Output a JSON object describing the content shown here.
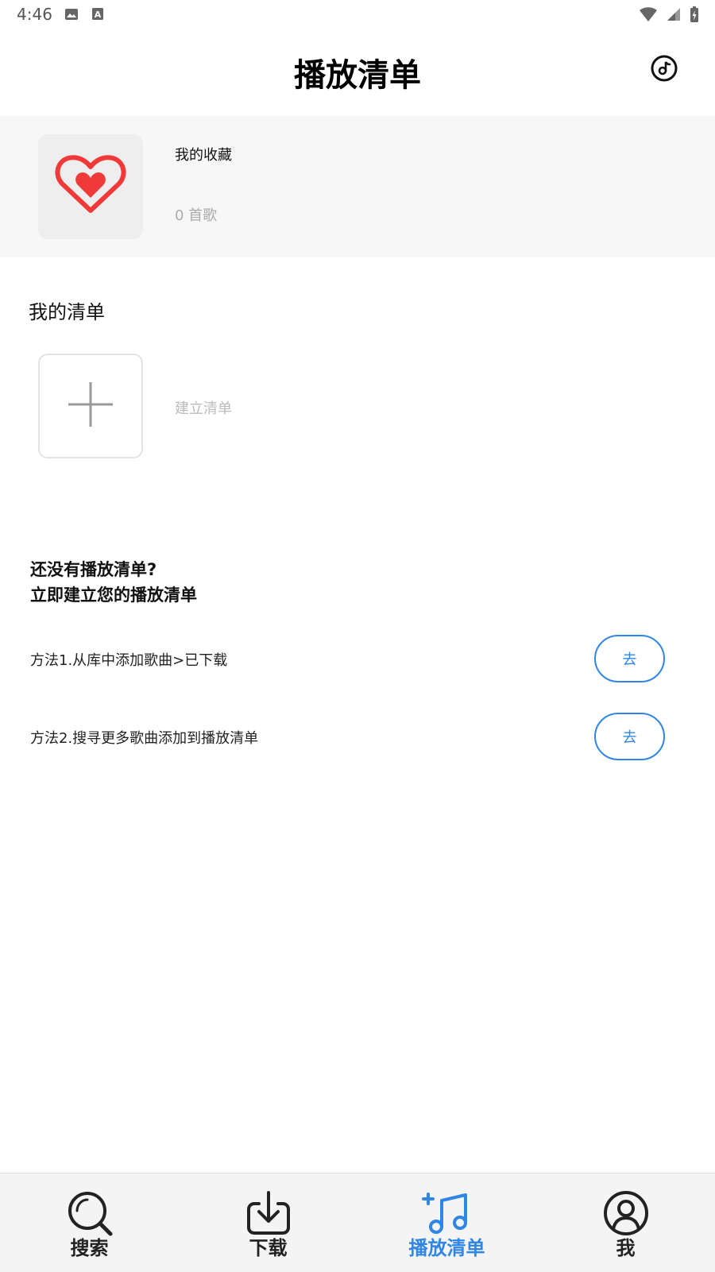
{
  "status_bar": {
    "time": "4:46"
  },
  "header": {
    "title": "播放清单"
  },
  "favorites": {
    "title": "我的收藏",
    "count": "0 首歌"
  },
  "my_playlists": {
    "heading": "我的清单",
    "create_label": "建立清单"
  },
  "empty_hint": {
    "line1": "还没有播放清单?",
    "line2": "立即建立您的播放清单",
    "methods": [
      {
        "text": "方法1.从库中添加歌曲>已下载",
        "button": "去"
      },
      {
        "text": "方法2.搜寻更多歌曲添加到播放清单",
        "button": "去"
      }
    ]
  },
  "bottom_nav": {
    "items": [
      {
        "label": "搜索",
        "icon": "search-icon"
      },
      {
        "label": "下载",
        "icon": "download-icon"
      },
      {
        "label": "播放清单",
        "icon": "playlist-icon",
        "active": true
      },
      {
        "label": "我",
        "icon": "profile-icon"
      }
    ]
  },
  "colors": {
    "accent": "#2f86e6",
    "heart": "#f03a3a"
  }
}
